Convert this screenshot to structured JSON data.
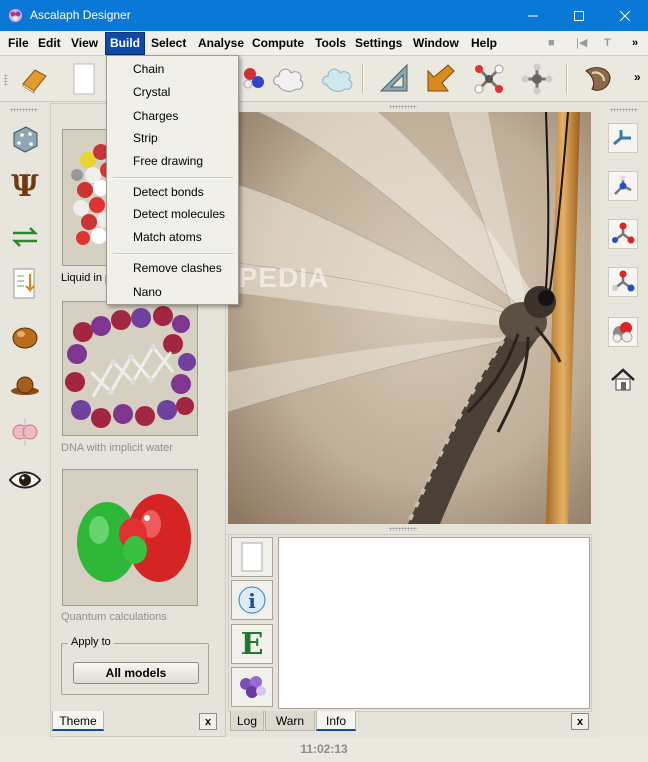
{
  "window": {
    "title": "Ascalaph Designer",
    "controls": [
      "minimize",
      "maximize",
      "close"
    ]
  },
  "menubar": {
    "items": [
      "File",
      "Edit",
      "View",
      "Build",
      "Select",
      "Analyse",
      "Compute",
      "Tools",
      "Settings",
      "Window",
      "Help"
    ],
    "active": "Build",
    "overflow": "»"
  },
  "build_menu": {
    "groups": [
      [
        "Chain",
        "Crystal",
        "Charges",
        "Strip",
        "Free drawing"
      ],
      [
        "Detect bonds",
        "Detect molecules",
        "Match atoms"
      ],
      [
        "Remove clashes",
        "Nano"
      ]
    ]
  },
  "toolbar": {
    "overflow": "»",
    "icons": [
      "book-icon",
      "new-page-icon",
      "spheres-icon",
      "cloud-outline-icon",
      "cloud-filled-icon",
      "triangle-ruler-icon",
      "arrow-icon",
      "molecule-x-icon",
      "molecule-star-icon",
      "shell-icon"
    ]
  },
  "theme_panel": {
    "thumbnails": [
      {
        "caption": "Liquid in p",
        "icon": "liquid-molecule-thumbnail"
      },
      {
        "caption": "DNA with implicit water",
        "icon": "dna-thumbnail"
      },
      {
        "caption": "Quantum calculations",
        "icon": "orbital-thumbnail"
      }
    ],
    "apply_to": {
      "legend": "Apply to",
      "button": "All models"
    },
    "tab": "Theme",
    "close": "x"
  },
  "log_panel": {
    "tabs": [
      "Log",
      "Warn",
      "Info"
    ],
    "active_tab": "Info",
    "close": "x",
    "buttons": [
      "page-icon",
      "info-icon",
      "e-icon",
      "molecule-icon"
    ]
  },
  "status": {
    "clock": "11:02:13"
  },
  "watermark": "SOFTPEDIA",
  "colors": {
    "titlebar": "#0a78d7",
    "menu_active": "#0f4ba6",
    "background": "#e6e3da"
  }
}
